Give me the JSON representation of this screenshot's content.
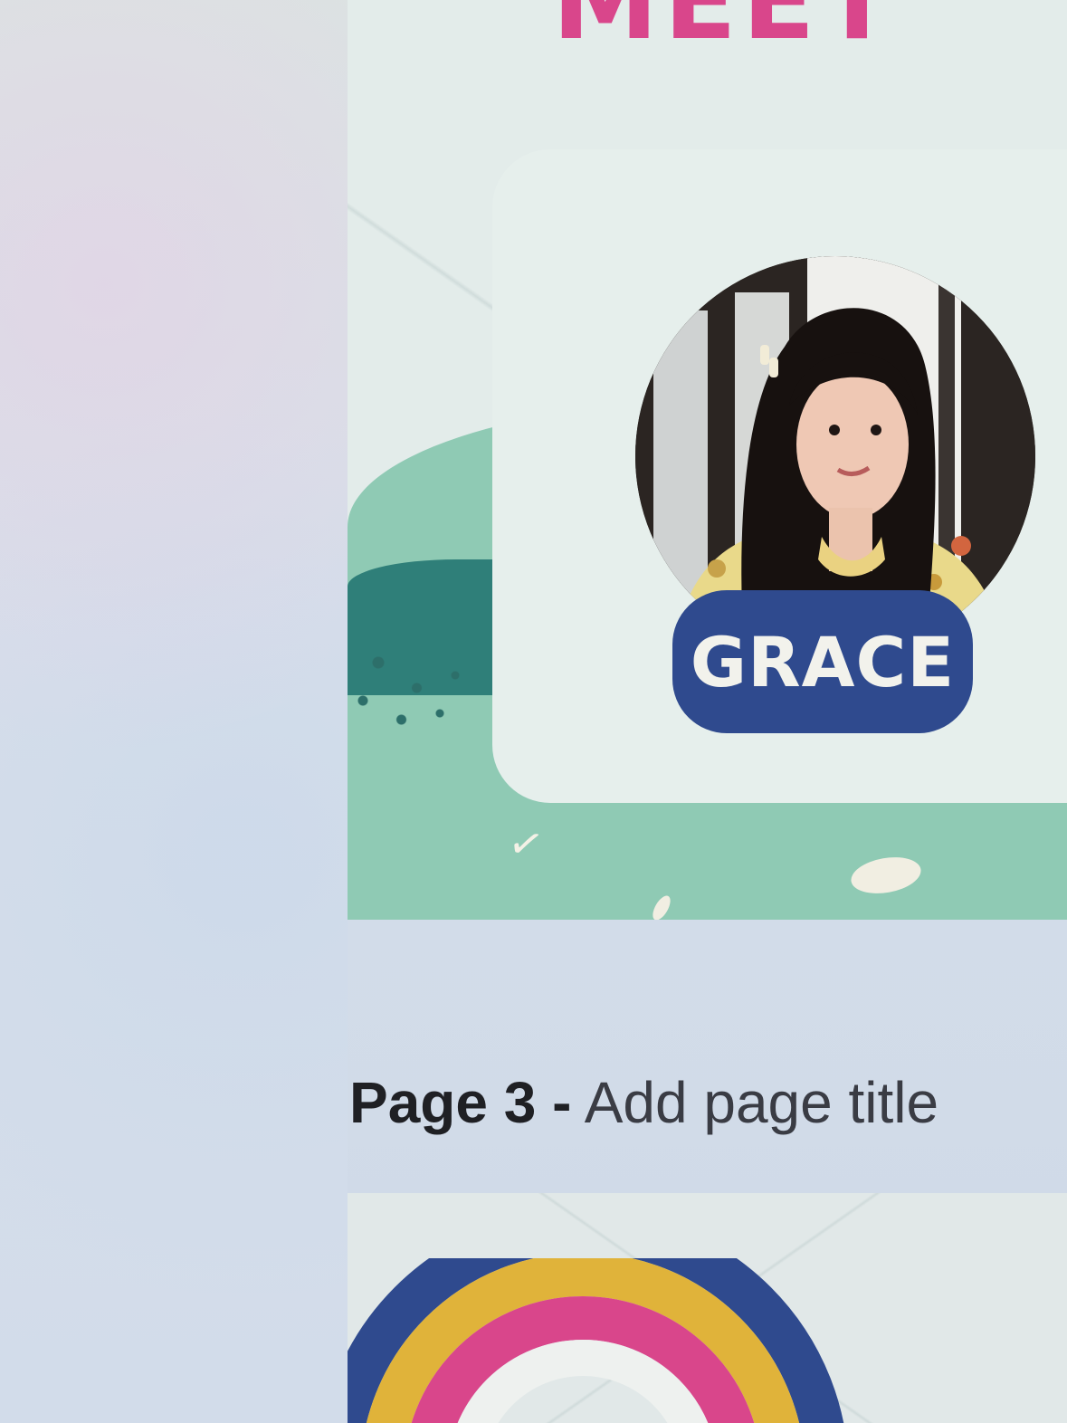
{
  "page2": {
    "heading": "MEET",
    "member": {
      "name": "GRACE",
      "photo_alt": "Grace profile photo"
    }
  },
  "page3": {
    "number_label": "Page 3",
    "separator": "-",
    "title_placeholder": "Add page title"
  },
  "colors": {
    "heading_pink": "#d9468b",
    "badge_navy": "#2f4a8e",
    "hill_mint": "#8fcab4",
    "hill_teal": "#2f7f79",
    "rainbow_navy": "#2f4a8e",
    "rainbow_yellow": "#e0b33a",
    "rainbow_pink": "#d9468b"
  }
}
